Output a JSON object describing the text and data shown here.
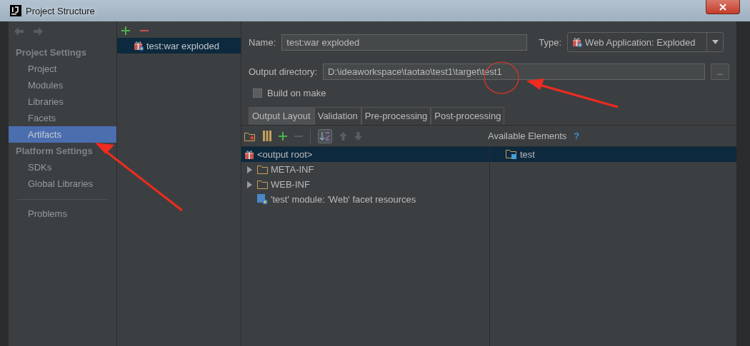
{
  "window": {
    "title": "Project Structure"
  },
  "sidebar": {
    "sections": [
      {
        "heading": "Project Settings",
        "items": [
          {
            "label": "Project",
            "selected": false
          },
          {
            "label": "Modules",
            "selected": false
          },
          {
            "label": "Libraries",
            "selected": false
          },
          {
            "label": "Facets",
            "selected": false
          },
          {
            "label": "Artifacts",
            "selected": true
          }
        ]
      },
      {
        "heading": "Platform Settings",
        "items": [
          {
            "label": "SDKs",
            "selected": false
          },
          {
            "label": "Global Libraries",
            "selected": false
          }
        ]
      }
    ],
    "footer_items": [
      {
        "label": "Problems",
        "selected": false
      }
    ]
  },
  "artifacts": {
    "items": [
      {
        "label": "test:war exploded",
        "selected": true
      }
    ]
  },
  "editor": {
    "name": {
      "label": "Name:",
      "value": "test:war exploded"
    },
    "type": {
      "label": "Type:",
      "value": "Web Application: Exploded"
    },
    "output_directory": {
      "label": "Output directory:",
      "value": "D:\\ideaworkspace\\taotao\\test1\\target\\test1",
      "browse": "..."
    },
    "build_on_make": {
      "label": "Build on make",
      "checked": false
    },
    "tabs": [
      {
        "label": "Output Layout",
        "selected": true
      },
      {
        "label": "Validation",
        "selected": false
      },
      {
        "label": "Pre-processing",
        "selected": false
      },
      {
        "label": "Post-processing",
        "selected": false
      }
    ],
    "layout_tree": [
      {
        "label": "<output root>",
        "kind": "root",
        "selected": true,
        "children": [
          {
            "label": "META-INF",
            "kind": "folder",
            "selected": false,
            "expanded": false
          },
          {
            "label": "WEB-INF",
            "kind": "folder",
            "selected": false,
            "expanded": false
          },
          {
            "label": "'test' module: 'Web' facet resources",
            "kind": "facet",
            "selected": false
          }
        ]
      }
    ],
    "available": {
      "header": "Available Elements",
      "help": "?",
      "items": [
        {
          "label": "test",
          "selected": true
        }
      ]
    }
  }
}
